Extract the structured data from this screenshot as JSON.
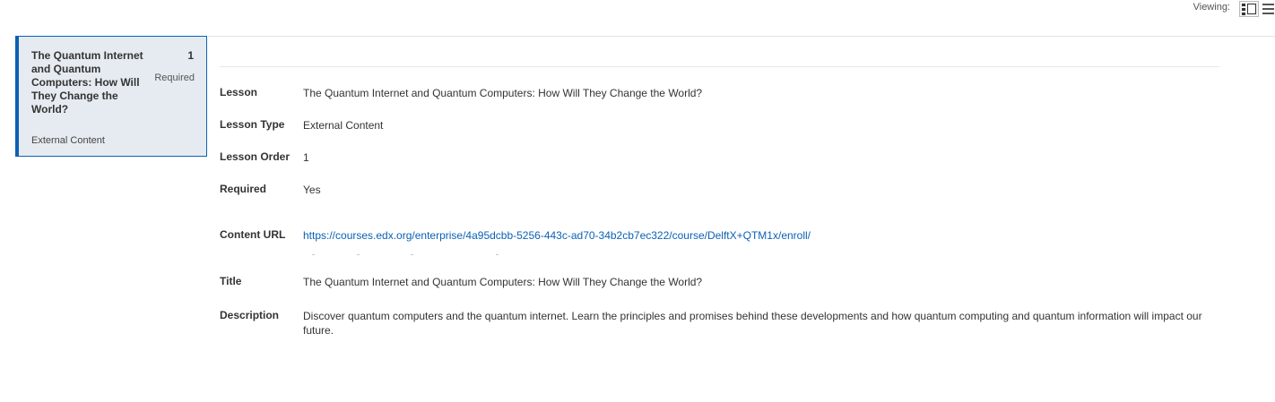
{
  "toolbar": {
    "viewing_label": "Viewing:",
    "icons": [
      "grid-view-icon",
      "list-view-icon"
    ]
  },
  "lesson_card": {
    "title": "The Quantum Internet and Quantum Computers: How Will They Change the World?",
    "order": "1",
    "required": "Required",
    "type": "External Content",
    "accent_color": "#0b61b5",
    "background_color": "#e6ebf1"
  },
  "details": {
    "lesson": {
      "label": "Lesson",
      "value": "The Quantum Internet and Quantum Computers: How Will They Change the World?"
    },
    "lesson_type": {
      "label": "Lesson Type",
      "value": "External Content"
    },
    "lesson_order": {
      "label": "Lesson Order",
      "value": "1"
    },
    "required": {
      "label": "Required",
      "value": "Yes"
    },
    "content_url": {
      "label": "Content URL",
      "value": "https://courses.edx.org/enterprise/4a95dcbb-5256-443c-ad70-34b2cb7ec322/course/DelftX+QTM1x/enroll/"
    },
    "title": {
      "label": "Title",
      "value": "The Quantum Internet and Quantum Computers: How Will They Change the World?"
    },
    "description": {
      "label": "Description",
      "value": "Discover quantum computers and the quantum internet. Learn the principles and promises behind these developments and how quantum computing and quantum information will impact our future."
    }
  },
  "colors": {
    "link": "#0b61b5",
    "text": "#333333"
  }
}
